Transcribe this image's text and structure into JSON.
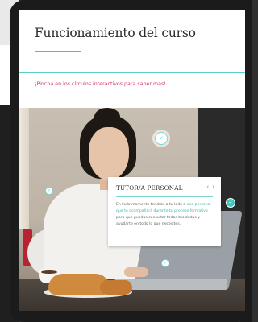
{
  "page": {
    "title": "Funcionamiento del curso",
    "subtitle": "¡Pincha en los círculos interactivos para saber más!"
  },
  "popup": {
    "title": "TUTOR/A PERSONAL",
    "prev_glyph": "‹",
    "next_glyph": "›",
    "body_before": "En todo momento tendrás a tu lado a ",
    "body_highlight": "una persona que te acompañará durante tu proceso formativo",
    "body_after": " para que puedas consultar todas tus dudas y ayudarte en todo lo que necesites."
  },
  "hotspots": [
    {
      "name": "hotspot-top",
      "icon": "check-icon",
      "glyph": "✓"
    },
    {
      "name": "hotspot-left",
      "icon": "check-icon",
      "glyph": "✓"
    },
    {
      "name": "hotspot-bottom",
      "icon": "check-icon",
      "glyph": "✓"
    },
    {
      "name": "hotspot-right",
      "icon": "check-icon",
      "glyph": "✓"
    }
  ],
  "colors": {
    "accent": "#3cc9c0",
    "subtitle": "#d6336f"
  }
}
